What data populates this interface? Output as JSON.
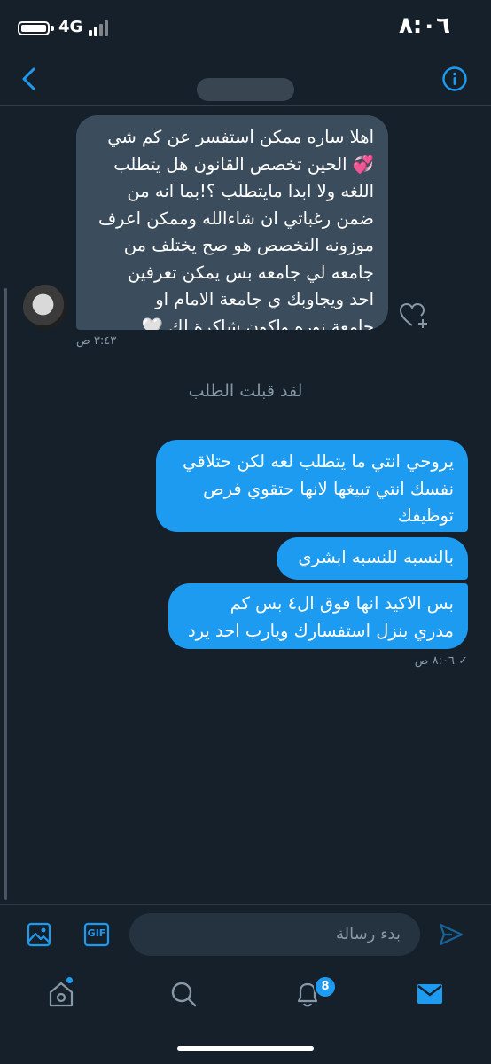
{
  "status_bar": {
    "network": "4G",
    "time": "٨:٠٦"
  },
  "incoming": {
    "lines": [
      "اهلا ساره ممكن استفسر عن كم شي",
      "💞 الحين تخصص القانون هل يتطلب",
      "اللغه ولا ابدا مايتطلب ؟!بما انه من",
      "ضمن رغباتي ان شاءالله وممكن اعرف",
      "موزونه التخصص هو صح يختلف من",
      "جامعه لي جامعه بس يمكن تعرفين",
      "احد ويجاوبك ي جامعة الامام او",
      "جامعة نوره واكون شاكرة لك 🤍"
    ],
    "time": "٣:٤٣ ص"
  },
  "notice": "لقد قبلت الطلب",
  "outgoing": {
    "bubble1": [
      "يروحي انتي ما يتطلب لغه لكن حتلاقي",
      "نفسك انتي تبيغها لانها حتقوي فرص",
      "توظيفك"
    ],
    "bubble2": [
      "بالنسبه للنسبه ابشري"
    ],
    "bubble3": [
      "بس الاكيد انها فوق ال٤  بس كم",
      "مدري بنزل استفسارك ويارب احد يرد"
    ],
    "time": "٨:٠٦ ص",
    "check": "✓"
  },
  "composer": {
    "gif_label": "GIF",
    "placeholder": "بدء رسالة"
  },
  "tabs": {
    "notifications_badge": "8"
  },
  "colors": {
    "background": "#15202b",
    "accent": "#1d9bf0",
    "incoming_bubble": "#3b4c5c",
    "muted": "#8899a6"
  }
}
